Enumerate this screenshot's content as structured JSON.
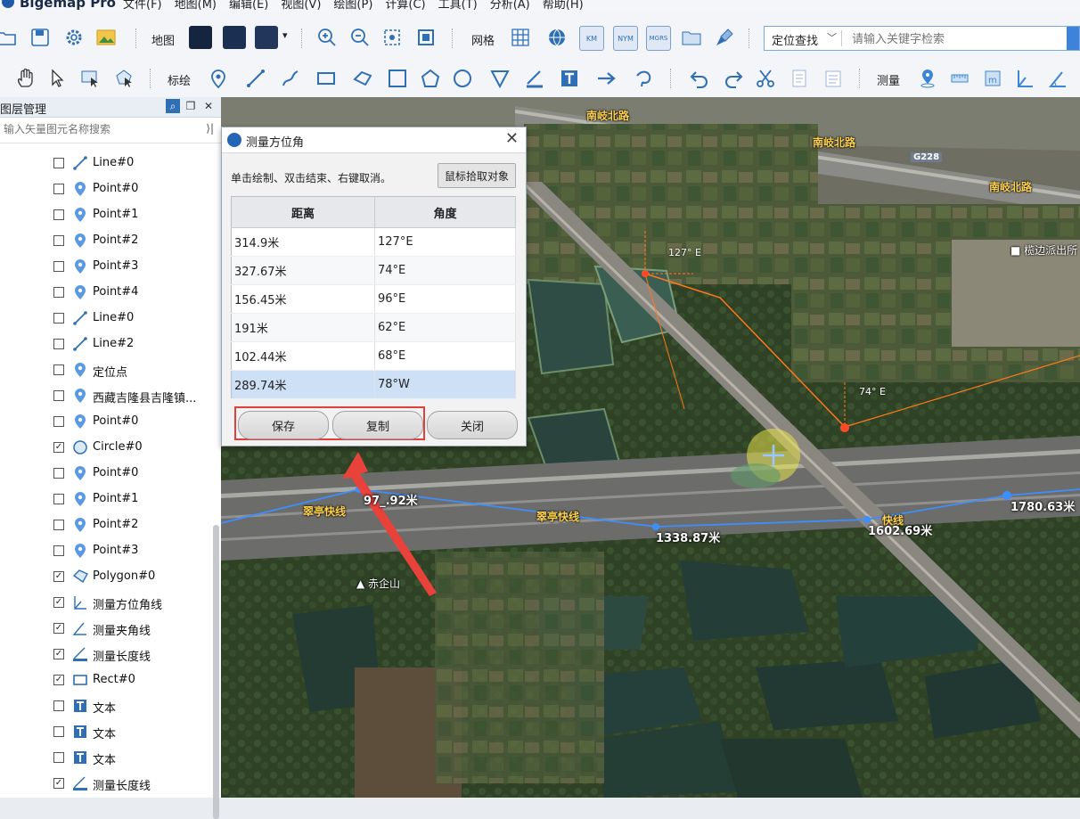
{
  "app": {
    "title": "Bigemap Pro"
  },
  "menu": [
    "文件(F)",
    "地图(M)",
    "编辑(E)",
    "视图(V)",
    "绘图(P)",
    "计算(C)",
    "工具(T)",
    "分析(A)",
    "帮助(H)"
  ],
  "toolbar1": {
    "map_label": "地图",
    "grid_label": "网格",
    "grid_buttons": [
      "LNG",
      "KM",
      "NYM",
      "MGRS"
    ],
    "search_mode": "定位查找",
    "search_placeholder": "请输入关键字检索"
  },
  "toolbar2": {
    "draw_label": "标绘",
    "measure_label": "测量"
  },
  "layer_panel": {
    "title": "图层管理",
    "search_placeholder": "输入矢量图元名称搜索",
    "items": [
      {
        "name": "Line#0",
        "icon": "line-icon",
        "checked": false
      },
      {
        "name": "Point#0",
        "icon": "point-icon",
        "checked": false
      },
      {
        "name": "Point#1",
        "icon": "point-icon",
        "checked": false
      },
      {
        "name": "Point#2",
        "icon": "point-icon",
        "checked": false
      },
      {
        "name": "Point#3",
        "icon": "point-icon",
        "checked": false
      },
      {
        "name": "Point#4",
        "icon": "point-icon",
        "checked": false
      },
      {
        "name": "Line#0",
        "icon": "line-icon",
        "checked": false
      },
      {
        "name": "Line#2",
        "icon": "line-icon",
        "checked": false
      },
      {
        "name": "定位点",
        "icon": "point-icon",
        "checked": false
      },
      {
        "name": "西藏吉隆县吉隆镇...",
        "icon": "point-icon",
        "checked": false
      },
      {
        "name": "Point#0",
        "icon": "point-icon",
        "checked": false
      },
      {
        "name": "Circle#0",
        "icon": "circle-icon",
        "checked": true
      },
      {
        "name": "Point#0",
        "icon": "point-icon",
        "checked": false
      },
      {
        "name": "Point#1",
        "icon": "point-icon",
        "checked": false
      },
      {
        "name": "Point#2",
        "icon": "point-icon",
        "checked": false
      },
      {
        "name": "Point#3",
        "icon": "point-icon",
        "checked": false
      },
      {
        "name": "Polygon#0",
        "icon": "polygon-icon",
        "checked": true
      },
      {
        "name": "测量方位角线",
        "icon": "azimuth-icon",
        "checked": true
      },
      {
        "name": "测量夹角线",
        "icon": "angle-icon",
        "checked": true
      },
      {
        "name": "测量长度线",
        "icon": "ruler-icon",
        "checked": true
      },
      {
        "name": "Rect#0",
        "icon": "rect-icon",
        "checked": true
      },
      {
        "name": "文本",
        "icon": "text-icon",
        "checked": false
      },
      {
        "name": "文本",
        "icon": "text-icon",
        "checked": false
      },
      {
        "name": "文本",
        "icon": "text-icon",
        "checked": false
      },
      {
        "name": "测量长度线",
        "icon": "ruler-icon",
        "checked": true
      }
    ]
  },
  "map": {
    "road_labels": [
      "南岐北路",
      "南岐北路",
      "南岐北路",
      "翠亭快线",
      "翠亭快线",
      "快线"
    ],
    "highway_code": "G228",
    "poi": [
      "榄边派出所",
      "赤企山"
    ],
    "angle_labels": [
      "127° E",
      "74° E"
    ],
    "distance_labels": [
      "97_.92米",
      "1338.87米",
      "1602.69米",
      "1780.63米"
    ]
  },
  "dialog": {
    "title": "测量方位角",
    "hint": "单击绘制、双击结束、右键取消。",
    "pick_button": "鼠标拾取对象",
    "columns": [
      "距离",
      "角度"
    ],
    "rows": [
      {
        "distance": "314.9米",
        "angle": "127°E"
      },
      {
        "distance": "327.67米",
        "angle": "74°E"
      },
      {
        "distance": "156.45米",
        "angle": "96°E"
      },
      {
        "distance": "191米",
        "angle": "62°E"
      },
      {
        "distance": "102.44米",
        "angle": "68°E"
      },
      {
        "distance": "289.74米",
        "angle": "78°W"
      }
    ],
    "save": "保存",
    "copy": "复制",
    "close": "关闭"
  }
}
